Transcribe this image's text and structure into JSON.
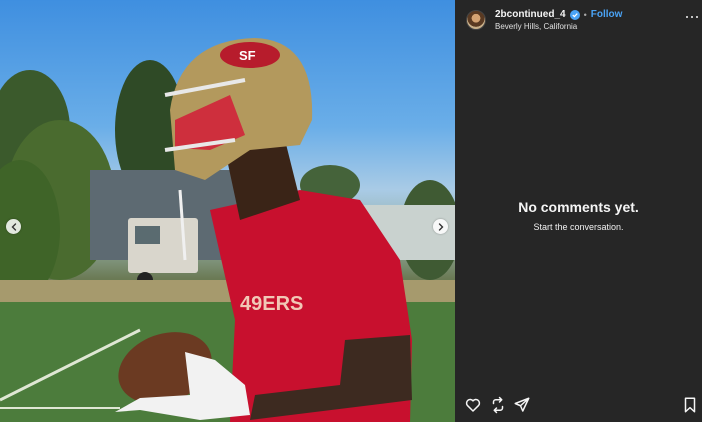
{
  "post": {
    "username": "2bcontinued_4",
    "separator": "•",
    "follow_label": "Follow",
    "location": "Beverly Hills, California"
  },
  "comments": {
    "empty_title": "No comments yet.",
    "empty_subtitle": "Start the conversation."
  },
  "photo": {
    "jersey_text": "49ERS",
    "helmet_logo": "SF"
  },
  "icons": {
    "prev": "chevron-left-icon",
    "next": "chevron-right-icon",
    "more": "more-options-icon",
    "verified": "verified-badge-icon",
    "like": "heart-icon",
    "repost": "repost-icon",
    "share": "send-icon",
    "save": "bookmark-icon"
  },
  "colors": {
    "panel": "#262626",
    "follow": "#4aa3f5",
    "jersey": "#c8102e",
    "helmet": "#b3995d"
  }
}
